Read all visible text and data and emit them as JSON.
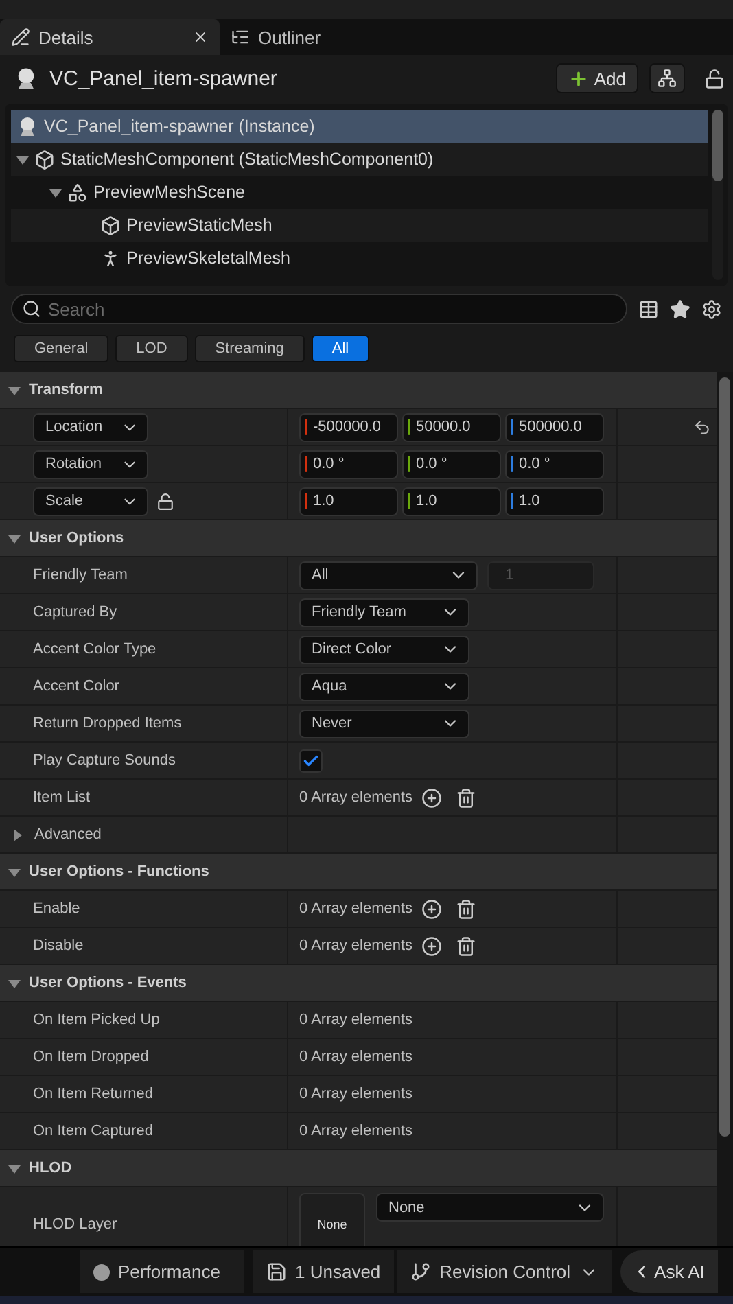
{
  "tabs": [
    {
      "label": "Details",
      "selected": true,
      "closable": true,
      "kind": "details"
    },
    {
      "label": "Outliner",
      "selected": false,
      "closable": false,
      "kind": "outliner"
    }
  ],
  "actor": {
    "title": "VC_Panel_item-spawner",
    "add_label": "Add"
  },
  "tree": [
    {
      "label": "VC_Panel_item-spawner (Instance)",
      "kind": "actor",
      "selected": true
    },
    {
      "label": "StaticMeshComponent (StaticMeshComponent0)",
      "kind": "mesh",
      "selected": false,
      "expanded": true,
      "children": [
        {
          "label": "PreviewMeshScene",
          "kind": "scene",
          "selected": false,
          "expanded": true,
          "children": [
            {
              "label": "PreviewStaticMesh",
              "kind": "mesh",
              "selected": false
            },
            {
              "label": "PreviewSkeletalMesh",
              "kind": "skeletal",
              "selected": false
            }
          ]
        }
      ]
    }
  ],
  "search": {
    "placeholder": "Search"
  },
  "filters": [
    {
      "label": "General",
      "selected": false
    },
    {
      "label": "LOD",
      "selected": false
    },
    {
      "label": "Streaming",
      "selected": false
    },
    {
      "label": "All",
      "selected": true
    }
  ],
  "sections": [
    {
      "title": "Transform",
      "expanded": true,
      "rows": [
        {
          "kind": "vector",
          "label": "Location",
          "values": [
            "-500000.0",
            "50000.0",
            "500000.0"
          ],
          "reset": true
        },
        {
          "kind": "vector",
          "label": "Rotation",
          "values": [
            "0.0 °",
            "0.0 °",
            "0.0 °"
          ]
        },
        {
          "kind": "vector",
          "label": "Scale",
          "values": [
            "1.0",
            "1.0",
            "1.0"
          ],
          "ratio_locked": false
        }
      ]
    },
    {
      "title": "User Options",
      "expanded": true,
      "rows": [
        {
          "kind": "combo",
          "label": "Friendly Team",
          "value": "All",
          "extra_value": "1"
        },
        {
          "kind": "combo",
          "label": "Captured By",
          "value": "Friendly Team"
        },
        {
          "kind": "combo",
          "label": "Accent Color Type",
          "value": "Direct Color"
        },
        {
          "kind": "combo",
          "label": "Accent Color",
          "value": "Aqua"
        },
        {
          "kind": "combo",
          "label": "Return Dropped Items",
          "value": "Never"
        },
        {
          "kind": "checkbox",
          "label": "Play Capture Sounds",
          "checked": true
        },
        {
          "kind": "array",
          "label": "Item List",
          "value": "0 Array elements",
          "buttons": true
        },
        {
          "kind": "group",
          "label": "Advanced",
          "expanded": false
        }
      ]
    },
    {
      "title": "User Options - Functions",
      "expanded": true,
      "rows": [
        {
          "kind": "array",
          "label": "Enable",
          "value": "0 Array elements",
          "buttons": true
        },
        {
          "kind": "array",
          "label": "Disable",
          "value": "0 Array elements",
          "buttons": true
        }
      ]
    },
    {
      "title": "User Options - Events",
      "expanded": true,
      "rows": [
        {
          "kind": "array",
          "label": "On Item Picked Up",
          "value": "0 Array elements",
          "buttons": false
        },
        {
          "kind": "array",
          "label": "On Item Dropped",
          "value": "0 Array elements",
          "buttons": false
        },
        {
          "kind": "array",
          "label": "On Item Returned",
          "value": "0 Array elements",
          "buttons": false
        },
        {
          "kind": "array",
          "label": "On Item Captured",
          "value": "0 Array elements",
          "buttons": false
        }
      ]
    },
    {
      "title": "HLOD",
      "expanded": true,
      "rows": [
        {
          "kind": "asset",
          "label": "HLOD Layer",
          "thumbnail": "None",
          "value": "None"
        }
      ]
    }
  ],
  "status_bar": [
    {
      "kind": "performance",
      "label": "Performance"
    },
    {
      "kind": "unsaved",
      "label": "1 Unsaved"
    },
    {
      "kind": "revision",
      "label": "Revision Control"
    },
    {
      "kind": "ai",
      "label": "Ask AI"
    }
  ]
}
